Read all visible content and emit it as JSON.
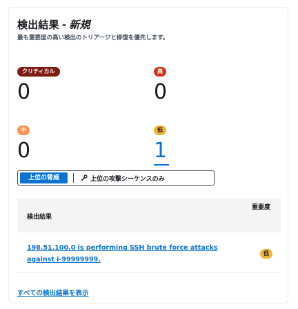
{
  "header": {
    "title_main": "検出結果",
    "title_sep": "-",
    "title_suffix": "新規",
    "subtitle": "最も重要度の高い検出のトリアージと修復を優先します。"
  },
  "severities": [
    {
      "label": "クリティカル",
      "count": "0",
      "color": "#7d1c13"
    },
    {
      "label": "高",
      "count": "0",
      "color": "#d13212"
    },
    {
      "label": "中",
      "count": "0",
      "color": "#f89256"
    },
    {
      "label": "低",
      "count": "1",
      "color": "#f2b33d"
    }
  ],
  "segmented": {
    "active_label": "上位の脅威",
    "other_label": "上位の攻撃シーケンスのみ",
    "other_icon": "wrench-icon"
  },
  "table": {
    "col_finding": "検出結果",
    "col_severity": "重要度",
    "rows": [
      {
        "finding": "198.51.100.0 is performing SSH brute force attacks against i-99999999.",
        "severity": "低"
      }
    ]
  },
  "footer": {
    "view_all": "すべての検出結果を表示"
  },
  "colors": {
    "link": "#0972d3",
    "segment_active": "#0972d3"
  }
}
